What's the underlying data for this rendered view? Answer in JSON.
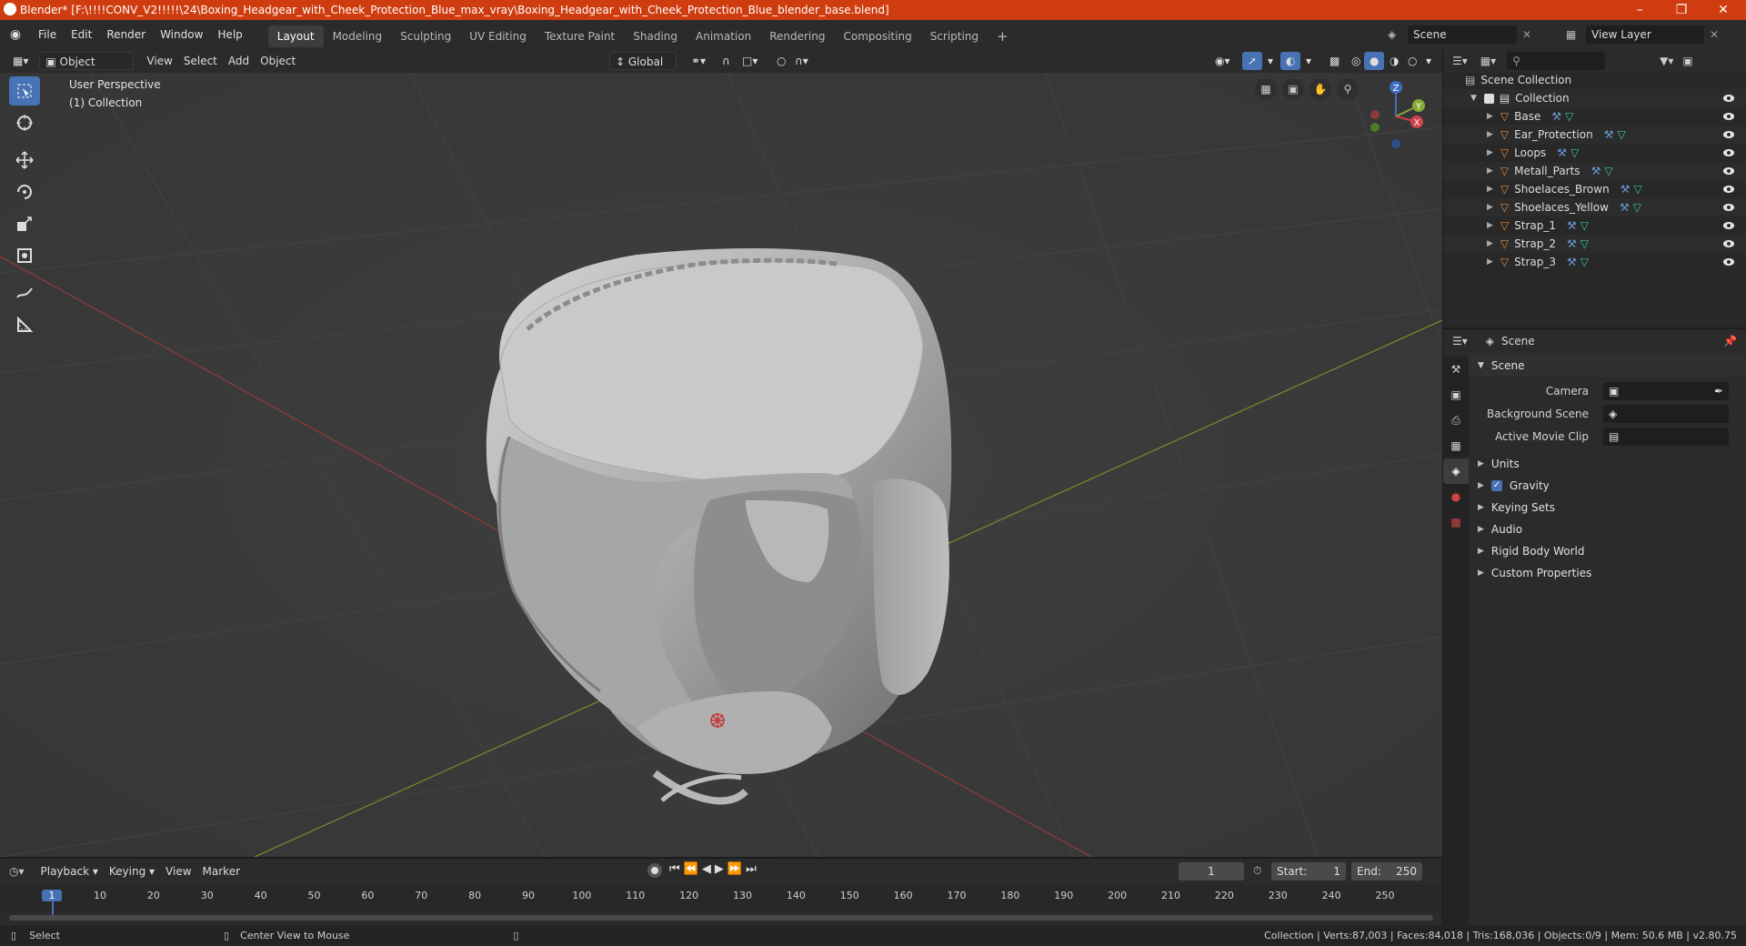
{
  "window": {
    "title": "Blender* [F:\\!!!!CONV_V2!!!!!\\24\\Boxing_Headgear_with_Cheek_Protection_Blue_max_vray\\Boxing_Headgear_with_Cheek_Protection_Blue_blender_base.blend]"
  },
  "menu": [
    "File",
    "Edit",
    "Render",
    "Window",
    "Help"
  ],
  "workspaces": [
    "Layout",
    "Modeling",
    "Sculpting",
    "UV Editing",
    "Texture Paint",
    "Shading",
    "Animation",
    "Rendering",
    "Compositing",
    "Scripting"
  ],
  "scene_field": "Scene",
  "viewlayer_field": "View Layer",
  "viewport_header": {
    "mode": "Object Mode",
    "view": "View",
    "select": "Select",
    "add": "Add",
    "object": "Object",
    "orientation": "Global"
  },
  "viewport": {
    "perspective": "User Perspective",
    "collection": "(1) Collection"
  },
  "axis": {
    "x": "X",
    "y": "Y",
    "z": "Z"
  },
  "outliner": {
    "root": "Scene Collection",
    "collection": "Collection",
    "objects": [
      "Base",
      "Ear_Protection",
      "Loops",
      "Metall_Parts",
      "Shoelaces_Brown",
      "Shoelaces_Yellow",
      "Strap_1",
      "Strap_2",
      "Strap_3"
    ]
  },
  "properties": {
    "header": "Scene",
    "section": "Scene",
    "camera_label": "Camera",
    "bg_scene_label": "Background Scene",
    "movie_clip_label": "Active Movie Clip",
    "panels": [
      "Units",
      "Gravity",
      "Keying Sets",
      "Audio",
      "Rigid Body World",
      "Custom Properties"
    ]
  },
  "timeline": {
    "playback": "Playback",
    "keying": "Keying",
    "view": "View",
    "marker": "Marker",
    "current_frame": "1",
    "start_label": "Start:",
    "start": "1",
    "end_label": "End:",
    "end": "250",
    "ticks": [
      "1",
      "10",
      "20",
      "30",
      "40",
      "50",
      "60",
      "70",
      "80",
      "90",
      "100",
      "110",
      "120",
      "130",
      "140",
      "150",
      "160",
      "170",
      "180",
      "190",
      "200",
      "210",
      "220",
      "230",
      "240",
      "250"
    ]
  },
  "status": {
    "select": "Select",
    "center": "Center View to Mouse",
    "stats": "Collection | Verts:87,003 | Faces:84,018 | Tris:168,036 | Objects:0/9 | Mem: 50.6 MB | v2.80.75"
  }
}
